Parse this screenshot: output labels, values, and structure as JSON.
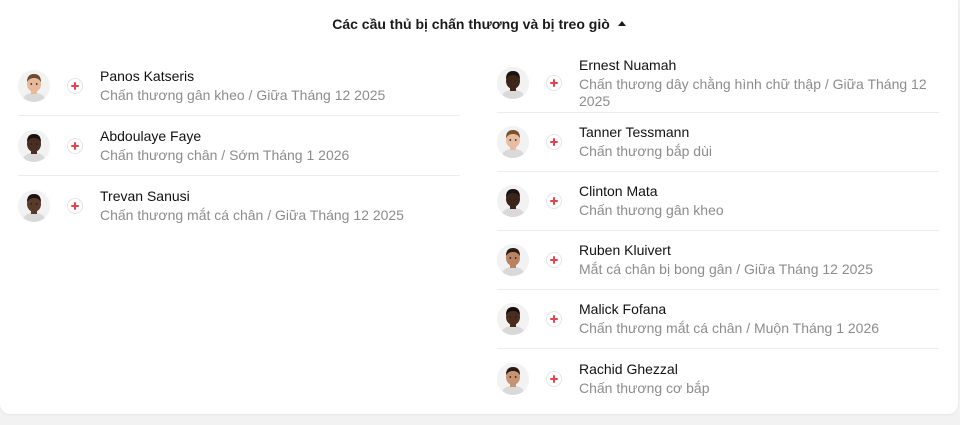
{
  "header": {
    "title": "Các cầu thủ bị chấn thương và bị treo giò"
  },
  "left_players": [
    {
      "name": "Panos Katseris",
      "detail": "Chấn thương gân kheo / Giữa Tháng 12 2025",
      "skin": "#e7b899",
      "hair": "#6b4a2f"
    },
    {
      "name": "Abdoulaye Faye",
      "detail": "Chấn thương chân / Sớm Tháng 1 2026",
      "skin": "#4a2e22",
      "hair": "#1a1210"
    },
    {
      "name": "Trevan Sanusi",
      "detail": "Chấn thương mắt cá chân / Giữa Tháng 12 2025",
      "skin": "#5a3a2a",
      "hair": "#1a1210"
    }
  ],
  "right_players": [
    {
      "name": "Ernest Nuamah",
      "detail": "Chấn thương dây chằng hình chữ thập / Giữa Tháng 12 2025",
      "skin": "#3e2619",
      "hair": "#1a1210"
    },
    {
      "name": "Tanner Tessmann",
      "detail": "Chấn thương bắp dùi",
      "skin": "#e8bc9f",
      "hair": "#7a4f2c"
    },
    {
      "name": "Clinton Mata",
      "detail": "Chấn thương gân kheo",
      "skin": "#3b2419",
      "hair": "#1a1210"
    },
    {
      "name": "Ruben Kluivert",
      "detail": "Mắt cá chân bị bong gân / Giữa Tháng 12 2025",
      "skin": "#b98260",
      "hair": "#2a1c14"
    },
    {
      "name": "Malick Fofana",
      "detail": "Chấn thương mắt cá chân / Muộn Tháng 1 2026",
      "skin": "#4a2d1f",
      "hair": "#140d0a"
    },
    {
      "name": "Rachid Ghezzal",
      "detail": "Chấn thương cơ bắp",
      "skin": "#c79473",
      "hair": "#2a1c14"
    }
  ],
  "colors": {
    "injury_cross": "#e5434b",
    "detail_text": "#8c8c8c"
  },
  "icons": {
    "toggle": "caret-up-icon",
    "injury": "medical-cross-icon"
  }
}
